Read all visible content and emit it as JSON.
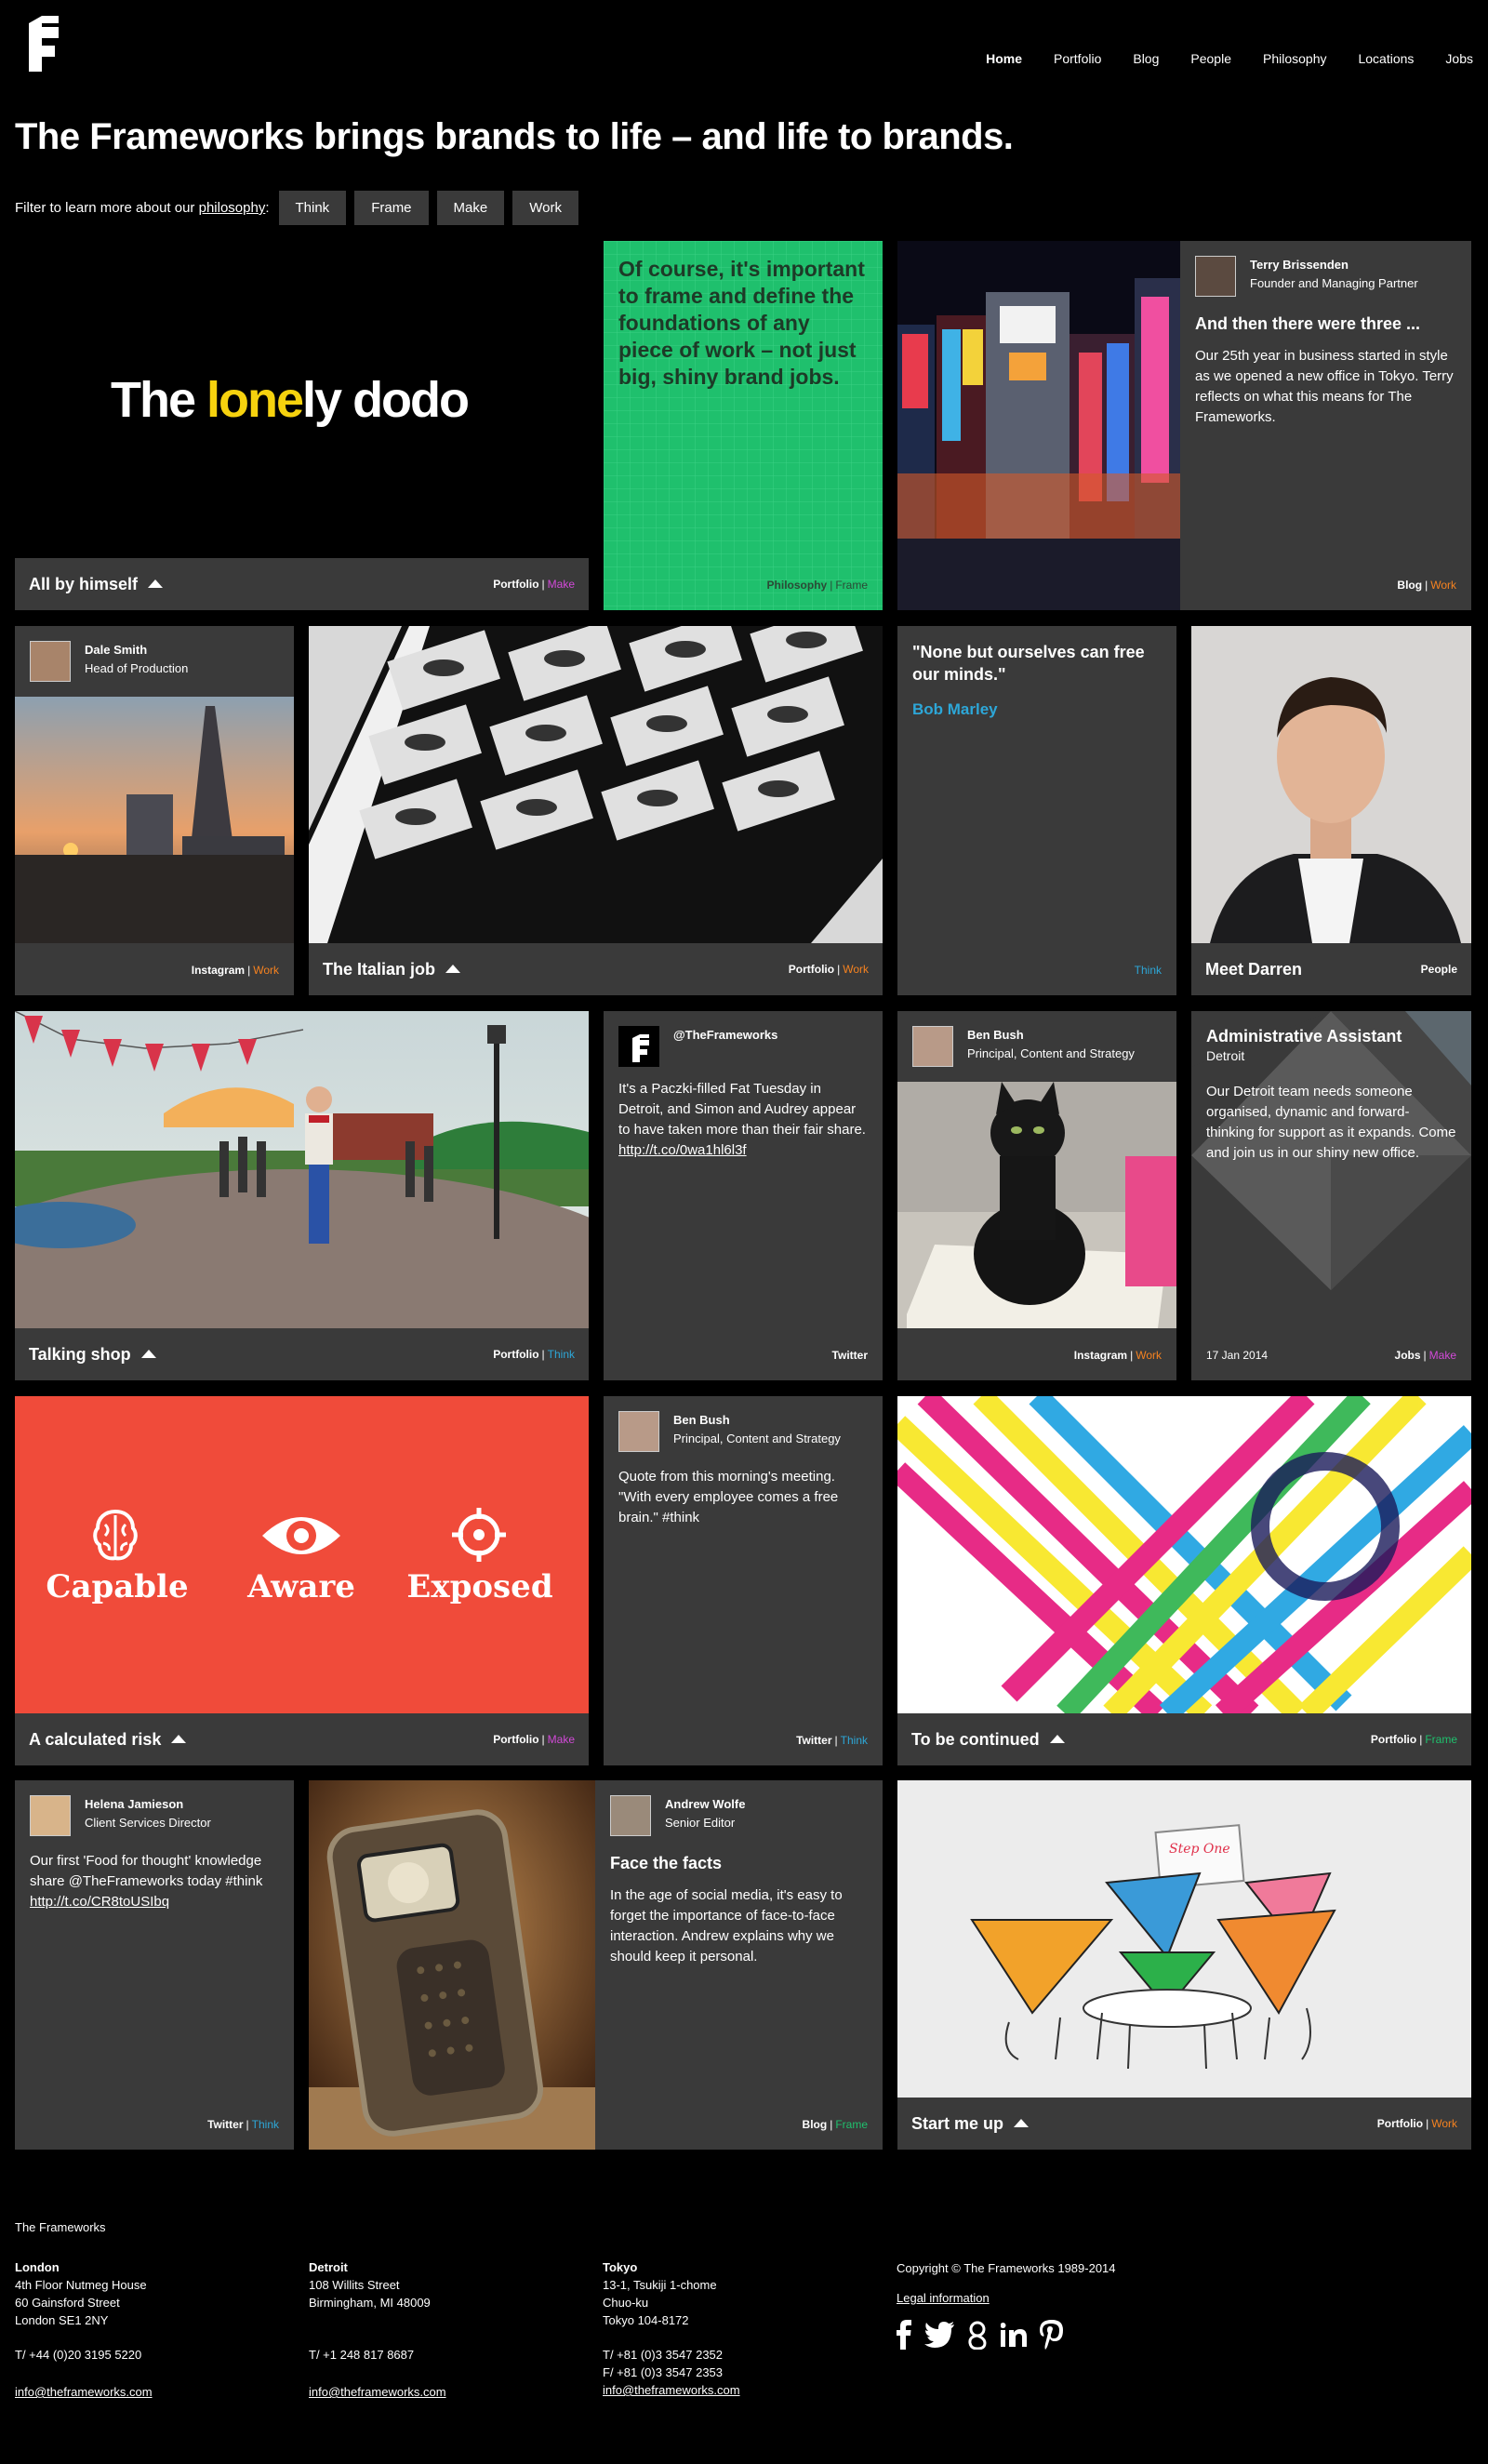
{
  "header": {
    "nav": [
      {
        "label": "Home",
        "active": true
      },
      {
        "label": "Portfolio"
      },
      {
        "label": "Blog"
      },
      {
        "label": "People"
      },
      {
        "label": "Philosophy"
      },
      {
        "label": "Locations"
      },
      {
        "label": "Jobs"
      }
    ],
    "headline": "The Frameworks brings brands to life – and life to brands."
  },
  "filter": {
    "prefix": "Filter to learn more about our",
    "link": "philosophy",
    "suffix": ":",
    "buttons": [
      "Think",
      "Frame",
      "Make",
      "Work"
    ]
  },
  "colors": {
    "make": "#d24ad8",
    "work": "#f58220",
    "think": "#2da7d8",
    "frame": "#1fc06d",
    "green_tile": "#1fc06d",
    "red_tile": "#f04b3a",
    "tile_bg": "#3a3a3a"
  },
  "tiles": {
    "dodo": {
      "logo_a": "The ",
      "logo_b": "lone",
      "logo_c": "ly dodo",
      "title": "All by himself",
      "tag1": "Portfolio",
      "tag2": "Make"
    },
    "philosophy": {
      "text": "Of course, it's important to frame and define the foundations of any piece of work – not just big, shiny brand jobs.",
      "tag1": "Philosophy",
      "tag2": "Frame"
    },
    "terry": {
      "name": "Terry Brissenden",
      "role": "Founder and Managing Partner",
      "title": "And then there were three ...",
      "text": "Our 25th year in business started in style as we opened a new office in Tokyo. Terry reflects on what this means for The Frameworks.",
      "tag1": "Blog",
      "tag2": "Work"
    },
    "dale": {
      "name": "Dale Smith",
      "role": "Head of Production",
      "tag1": "Instagram",
      "tag2": "Work"
    },
    "italian": {
      "title": "The Italian job",
      "tag1": "Portfolio",
      "tag2": "Work"
    },
    "quote": {
      "text": "\"None but ourselves can free our minds.\"",
      "author": "Bob Marley",
      "tag": "Think"
    },
    "darren": {
      "title": "Meet Darren",
      "tag": "People"
    },
    "talking": {
      "title": "Talking shop",
      "tag1": "Portfolio",
      "tag2": "Think"
    },
    "twitter1": {
      "handle": "@TheFrameworks",
      "text": "It's a Paczki-filled Fat Tuesday in Detroit, and Simon and Audrey appear to have taken more than their fair share.",
      "link": "http://t.co/0wa1hl6l3f",
      "tag": "Twitter"
    },
    "ben1": {
      "name": "Ben Bush",
      "role": "Principal, Content and Strategy",
      "tag1": "Instagram",
      "tag2": "Work"
    },
    "job": {
      "title": "Administrative Assistant",
      "location": "Detroit",
      "text": "Our Detroit team needs someone organised, dynamic and forward-thinking for support as it expands. Come and join us in our shiny new office.",
      "date": "17 Jan 2014",
      "tag1": "Jobs",
      "tag2": "Make"
    },
    "risk": {
      "w1": "Capable",
      "w2": "Aware",
      "w3": "Exposed",
      "title": "A calculated risk",
      "tag1": "Portfolio",
      "tag2": "Make"
    },
    "ben2": {
      "name": "Ben Bush",
      "role": "Principal, Content and Strategy",
      "text": "Quote from this morning's meeting. \"With every employee comes a free brain.\" #think",
      "tag1": "Twitter",
      "tag2": "Think"
    },
    "continued": {
      "title": "To be continued",
      "tag1": "Portfolio",
      "tag2": "Frame"
    },
    "helena": {
      "name": "Helena Jamieson",
      "role": "Client Services Director",
      "text": "Our first 'Food for thought' knowledge share @TheFrameworks today #think",
      "link": "http://t.co/CR8toUSIbq",
      "tag1": "Twitter",
      "tag2": "Think"
    },
    "andrew": {
      "name": "Andrew Wolfe",
      "role": "Senior Editor",
      "title": "Face the facts",
      "text": "In the age of social media, it's easy to forget the importance of face-to-face interaction. Andrew explains why we should keep it personal.",
      "tag1": "Blog",
      "tag2": "Frame"
    },
    "startme": {
      "sign": "Step One",
      "title": "Start me up",
      "tag1": "Portfolio",
      "tag2": "Work"
    }
  },
  "footer": {
    "company": "The Frameworks",
    "london": {
      "city": "London",
      "l1": "4th Floor Nutmeg House",
      "l2": "60 Gainsford Street",
      "l3": "London SE1 2NY",
      "tel": "T/ +44 (0)20 3195 5220",
      "email": "info@theframeworks.com"
    },
    "detroit": {
      "city": "Detroit",
      "l1": "108 Willits Street",
      "l2": "Birmingham, MI 48009",
      "tel": "T/ +1 248 817 8687",
      "email": "info@theframeworks.com"
    },
    "tokyo": {
      "city": "Tokyo",
      "l1": "13-1, Tsukiji 1-chome",
      "l2": "Chuo-ku",
      "l3": "Tokyo 104-8172",
      "tel": "T/ +81 (0)3 3547 2352",
      "fax": "F/ +81 (0)3 3547 2353",
      "email": "info@theframeworks.com"
    },
    "copyright": "Copyright © The Frameworks 1989-2014",
    "legal": "Legal information"
  }
}
